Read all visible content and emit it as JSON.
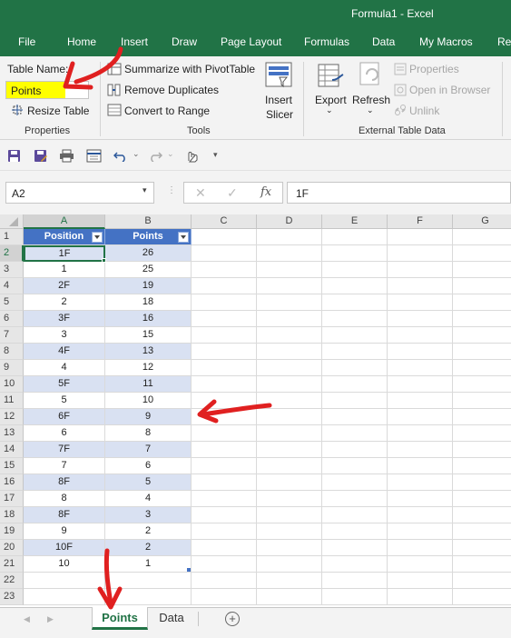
{
  "window": {
    "title": "Formula1  -  Excel"
  },
  "menu": {
    "tabs": [
      "File",
      "Home",
      "Insert",
      "Draw",
      "Page Layout",
      "Formulas",
      "Data",
      "My Macros",
      "Rev"
    ]
  },
  "ribbon": {
    "properties": {
      "table_name_label": "Table Name:",
      "table_name_value": "Points",
      "resize_label": "Resize Table",
      "group_label": "Properties"
    },
    "tools": {
      "summarize_label": "Summarize with PivotTable",
      "remove_dup_label": "Remove Duplicates",
      "convert_label": "Convert to Range",
      "insert_slicer_label": "Insert\nSlicer",
      "insert_label": "Insert",
      "slicer_label": "Slicer",
      "group_label": "Tools"
    },
    "external": {
      "export_label": "Export",
      "refresh_label": "Refresh",
      "properties_label": "Properties",
      "open_browser_label": "Open in Browser",
      "unlink_label": "Unlink",
      "group_label": "External Table Data"
    }
  },
  "formula_bar": {
    "name_box": "A2",
    "formula": "1F"
  },
  "grid": {
    "columns": [
      "A",
      "B",
      "C",
      "D",
      "E",
      "F",
      "G"
    ],
    "row_numbers": [
      "1",
      "2",
      "3",
      "4",
      "5",
      "6",
      "7",
      "8",
      "9",
      "10",
      "11",
      "12",
      "13",
      "14",
      "15",
      "16",
      "17",
      "18",
      "19",
      "20",
      "21",
      "22",
      "23"
    ],
    "table": {
      "headers": [
        "Position",
        "Points"
      ],
      "rows": [
        [
          "1F",
          "26"
        ],
        [
          "1",
          "25"
        ],
        [
          "2F",
          "19"
        ],
        [
          "2",
          "18"
        ],
        [
          "3F",
          "16"
        ],
        [
          "3",
          "15"
        ],
        [
          "4F",
          "13"
        ],
        [
          "4",
          "12"
        ],
        [
          "5F",
          "11"
        ],
        [
          "5",
          "10"
        ],
        [
          "6F",
          "9"
        ],
        [
          "6",
          "8"
        ],
        [
          "7F",
          "7"
        ],
        [
          "7",
          "6"
        ],
        [
          "8F",
          "5"
        ],
        [
          "8",
          "4"
        ],
        [
          "8F",
          "3"
        ],
        [
          "9",
          "2"
        ],
        [
          "10F",
          "2"
        ],
        [
          "10",
          "1"
        ]
      ]
    }
  },
  "sheets": {
    "tabs": [
      "Points",
      "Data"
    ],
    "active": "Points"
  },
  "colors": {
    "excel_green": "#217346",
    "table_header": "#4472c4",
    "band": "#d9e1f2",
    "highlight": "#ffff00",
    "annotation_arrow": "#e02020"
  }
}
